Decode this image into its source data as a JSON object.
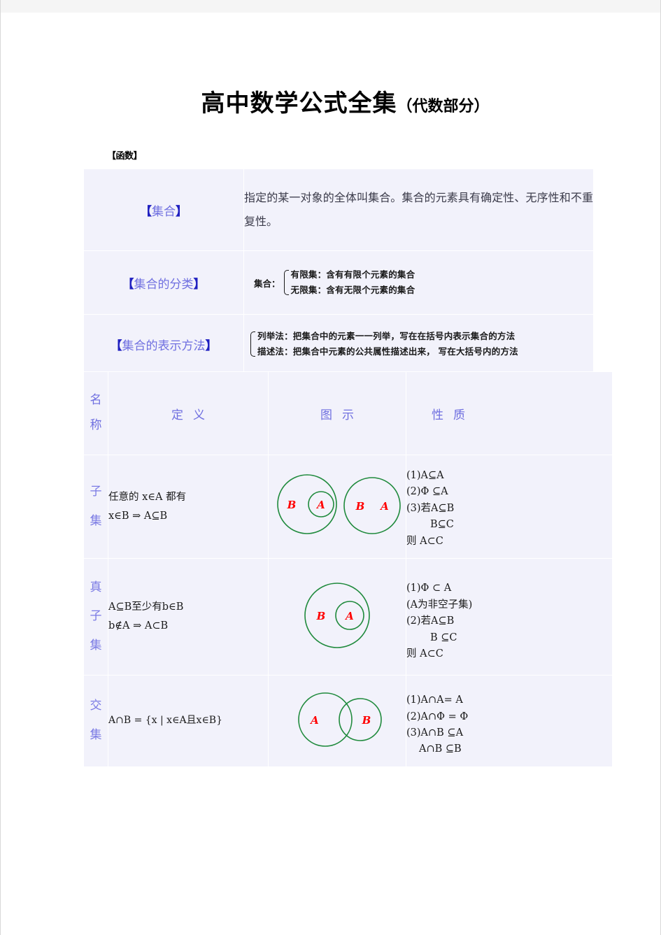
{
  "document": {
    "title_main": "高中数学公式全集",
    "title_sub": "（代数部分）",
    "section_tag": "【函数】"
  },
  "colors": {
    "table_bg": "#f2f2fb",
    "heading_blue": "#6f6fe0",
    "bracket_blue": "#2020c0",
    "venn_stroke": "#1f8a3c",
    "venn_label": "#ff0000",
    "body_text": "#3b3b4a"
  },
  "basic_table": {
    "rows": [
      {
        "label_open": "【",
        "label_text": "集合",
        "label_close": "】",
        "kind": "paragraph",
        "content": "指定的某一对象的全体叫集合。集合的元素具有确定性、无序性和不重复性。"
      },
      {
        "label_open": "【",
        "label_text": "集合的分类",
        "label_close": "】",
        "kind": "brace",
        "lead": "集合：",
        "lines": [
          "有限集：含有有限个元素的集合",
          "无限集：含有无限个元素的集合"
        ]
      },
      {
        "label_open": "【",
        "label_text": "集合的表示方法",
        "label_close": "】",
        "kind": "brace",
        "lead": "",
        "lines": [
          "列举法：把集合中的元素一一列举，写在在括号内表示集合的方法",
          "描述法：把集合中元素的公共属性描述出来， 写在大括号内的方法"
        ]
      }
    ]
  },
  "relation_table": {
    "headers": {
      "name": "名称",
      "definition": "定义",
      "figure": "图示",
      "property": "性质"
    },
    "rows": [
      {
        "name": "子集",
        "definition_lines": [
          "任意的 x∈A 都有",
          "x∈B ⇒ A⊆B"
        ],
        "figure": "two-diagrams-nested-and-equal",
        "figure_labels": [
          "B",
          "A",
          "B",
          "A"
        ],
        "property_lines": [
          "(1)A⊆A",
          "(2)Φ ⊆A",
          "(3)若A⊆B",
          "B⊆C",
          "则    A⊂C"
        ]
      },
      {
        "name": "真子集",
        "definition_lines": [
          "A⊆B至少有b∈B",
          "b∉A ⇒ A⊂B"
        ],
        "figure": "single-nested-diagram",
        "figure_labels": [
          "B",
          "A"
        ],
        "property_lines": [
          "(1)Φ ⊂ A",
          "(A为非空子集)",
          "(2)若A⊆B",
          "B ⊆C",
          "则    A⊂C"
        ]
      },
      {
        "name": "交集",
        "definition_lines": [
          "A∩B = {x | x∈A且x∈B}"
        ],
        "figure": "two-overlapping-circles",
        "figure_labels": [
          "A",
          "B"
        ],
        "property_lines": [
          "(1)A∩A= A",
          "(2)A∩Φ = Φ",
          "(3)A∩B ⊆A",
          "A∩B ⊆B"
        ]
      }
    ]
  }
}
